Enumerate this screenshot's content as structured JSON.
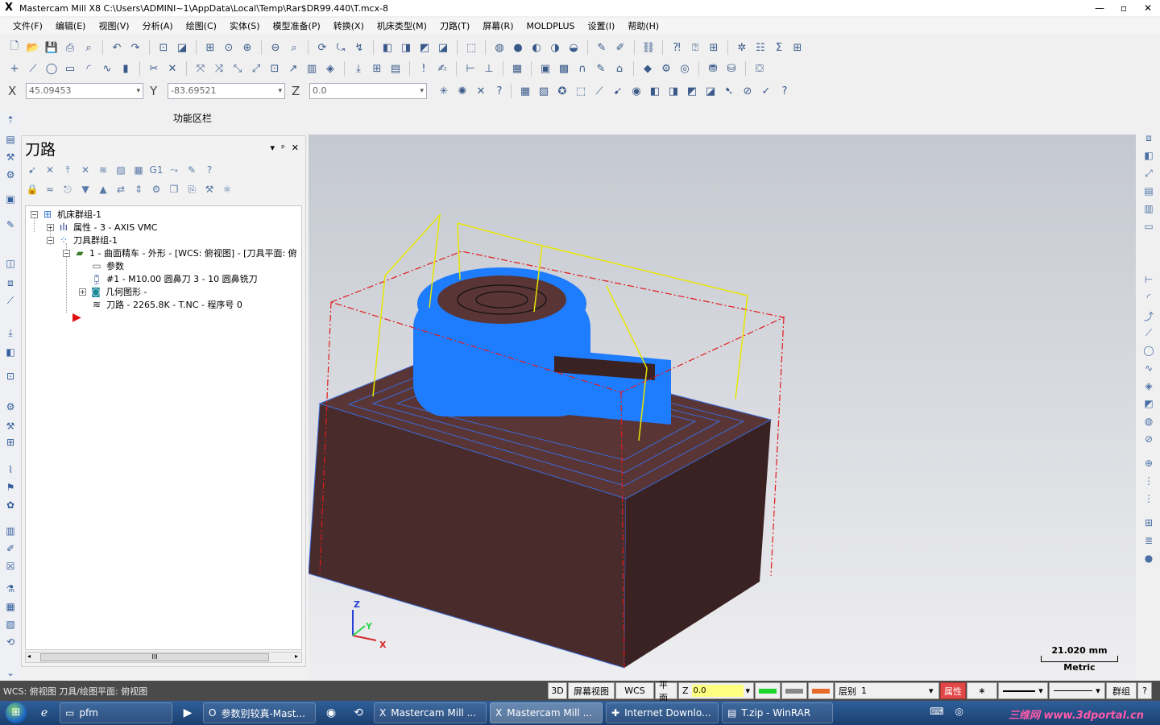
{
  "window": {
    "title": "Mastercam Mill X8  C:\\Users\\ADMINI~1\\AppData\\Local\\Temp\\Rar$DR99.440\\T.mcx-8",
    "app_icon": "X",
    "controls": [
      "—",
      "▫",
      "✕"
    ]
  },
  "menu": [
    "文件(F)",
    "编辑(E)",
    "视图(V)",
    "分析(A)",
    "绘图(C)",
    "实体(S)",
    "模型准备(P)",
    "转换(X)",
    "机床类型(M)",
    "刀路(T)",
    "屏幕(R)",
    "MOLDPLUS",
    "设置(I)",
    "帮助(H)"
  ],
  "coords": {
    "x_label": "X",
    "x_value": "45.09453",
    "y_label": "Y",
    "y_value": "-83.69521",
    "z_label": "Z",
    "z_value": "0.0"
  },
  "function_area_label": "功能区栏",
  "panel": {
    "title": "刀路",
    "pin": "▾",
    "dock": "ᵖ",
    "close": "✕",
    "tree": {
      "machine_group": "机床群组-1",
      "properties": "属性 - 3 - AXIS VMC",
      "tool_group": "刀具群组-1",
      "operation": "1 - 曲面精车 - 外形 - [WCS: 俯视图] - [刀具平面: 俯",
      "params": "参数",
      "tool": "#1 - M10.00 圆鼻刀 3 - 10 圆鼻铣刀",
      "geometry": "几何图形 -",
      "toolpath": "刀路 - 2265.8K - T.NC - 程序号 0"
    },
    "scroll_thumb": "III"
  },
  "viewport": {
    "axis_x": "X",
    "axis_y": "Y",
    "axis_z": "Z",
    "scale_value": "21.020 mm",
    "scale_unit": "Metric",
    "colors": {
      "stock": "#4a2b2b",
      "toolpath": "#1e7cff",
      "bounds_red": "#e01b1b",
      "bounds_yellow": "#e6e600"
    }
  },
  "status": {
    "wcs_text": "WCS: 俯视图  刀具/绘图平面: 俯视图",
    "btn_3d": "3D",
    "btn_screen_view": "屏幕视图",
    "btn_wcs": "WCS",
    "btn_plane": "平面",
    "z_label": "Z",
    "z_value": "0.0",
    "level_label": "层别",
    "level_value": "1",
    "attr_label": "属性",
    "group_label": "群组",
    "help_label": "?",
    "star_label": "∗"
  },
  "taskbar": {
    "items": [
      {
        "icon": "folder-icon",
        "glyph": "▭",
        "label": "pfm"
      },
      {
        "icon": "opera-icon",
        "glyph": "O",
        "label": "参数别较真-Mast..."
      },
      {
        "icon": "mastercam-icon",
        "glyph": "X",
        "label": "Mastercam Mill ..."
      },
      {
        "icon": "mastercam-icon",
        "glyph": "X",
        "label": "Mastercam Mill ..."
      },
      {
        "icon": "download-icon",
        "glyph": "✚",
        "label": "Internet Downlo..."
      },
      {
        "icon": "winrar-icon",
        "glyph": "▤",
        "label": "T.zip - WinRAR"
      }
    ],
    "watermark": "三维网 www.3dportal.cn"
  }
}
